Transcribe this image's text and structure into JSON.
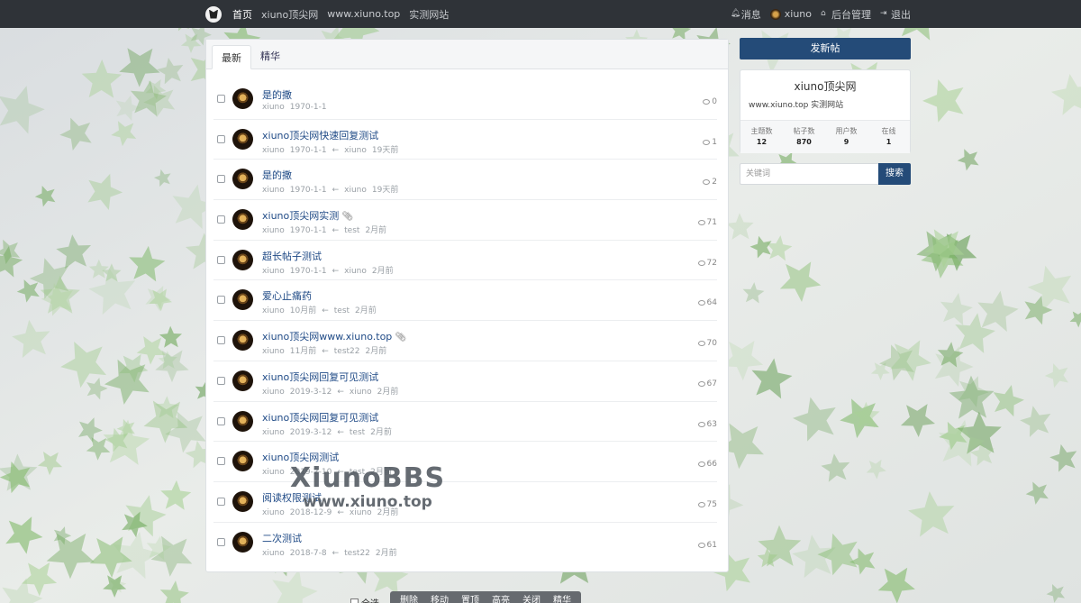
{
  "nav": {
    "links": [
      "首页",
      "xiuno顶尖网",
      "www.xiuno.top",
      "实测网站"
    ],
    "right": {
      "messages": "消息",
      "user": "xiuno",
      "admin": "后台管理",
      "logout": "退出"
    }
  },
  "tabs": [
    "最新",
    "精华"
  ],
  "threads": [
    {
      "title": "是的撒",
      "author": "xiuno",
      "date": "1970-1-1",
      "last_user": "",
      "last_time": "",
      "replies": "0",
      "attach": false
    },
    {
      "title": "xiuno顶尖网快速回复测试",
      "author": "xiuno",
      "date": "1970-1-1",
      "last_user": "xiuno",
      "last_time": "19天前",
      "replies": "1",
      "attach": false
    },
    {
      "title": "是的撒",
      "author": "xiuno",
      "date": "1970-1-1",
      "last_user": "xiuno",
      "last_time": "19天前",
      "replies": "2",
      "attach": false
    },
    {
      "title": "xiuno顶尖网实测",
      "author": "xiuno",
      "date": "1970-1-1",
      "last_user": "test",
      "last_time": "2月前",
      "replies": "71",
      "attach": true
    },
    {
      "title": "超长帖子测试",
      "author": "xiuno",
      "date": "1970-1-1",
      "last_user": "xiuno",
      "last_time": "2月前",
      "replies": "72",
      "attach": false
    },
    {
      "title": "爱心止痛药",
      "author": "xiuno",
      "date": "10月前",
      "last_user": "test",
      "last_time": "2月前",
      "replies": "64",
      "attach": false
    },
    {
      "title": "xiuno顶尖网www.xiuno.top",
      "author": "xiuno",
      "date": "11月前",
      "last_user": "test22",
      "last_time": "2月前",
      "replies": "70",
      "attach": true
    },
    {
      "title": "xiuno顶尖网回复可见测试",
      "author": "xiuno",
      "date": "2019-3-12",
      "last_user": "xiuno",
      "last_time": "2月前",
      "replies": "67",
      "attach": false
    },
    {
      "title": "xiuno顶尖网回复可见测试",
      "author": "xiuno",
      "date": "2019-3-12",
      "last_user": "test",
      "last_time": "2月前",
      "replies": "63",
      "attach": false
    },
    {
      "title": "xiuno顶尖网测试",
      "author": "xiuno",
      "date": "2019-2-10",
      "last_user": "test",
      "last_time": "2月前",
      "replies": "66",
      "attach": false
    },
    {
      "title": "阅读权限测试",
      "author": "xiuno",
      "date": "2018-12-9",
      "last_user": "xiuno",
      "last_time": "2月前",
      "replies": "75",
      "attach": false
    },
    {
      "title": "二次测试",
      "author": "xiuno",
      "date": "2018-7-8",
      "last_user": "test22",
      "last_time": "2月前",
      "replies": "61",
      "attach": false
    }
  ],
  "sidebar": {
    "post_button": "发新帖",
    "site_name": "xiuno顶尖网",
    "site_desc": "www.xiuno.top 实测网站",
    "stats": [
      {
        "label": "主题数",
        "value": "12"
      },
      {
        "label": "帖子数",
        "value": "870"
      },
      {
        "label": "用户数",
        "value": "9"
      },
      {
        "label": "在线",
        "value": "1"
      }
    ],
    "search_placeholder": "关键词",
    "search_button": "搜索"
  },
  "toolbar": {
    "select_all": "全选",
    "actions": [
      "删除",
      "移动",
      "置顶",
      "高亮",
      "关闭",
      "精华"
    ]
  },
  "watermark": {
    "line1": "XiunoBBS",
    "line2": "www.xiuno.top"
  },
  "colors": {
    "nav_bg": "#2f3338",
    "primary": "#244b78",
    "link": "#1f4a86",
    "star_green": "#7fb56a"
  }
}
